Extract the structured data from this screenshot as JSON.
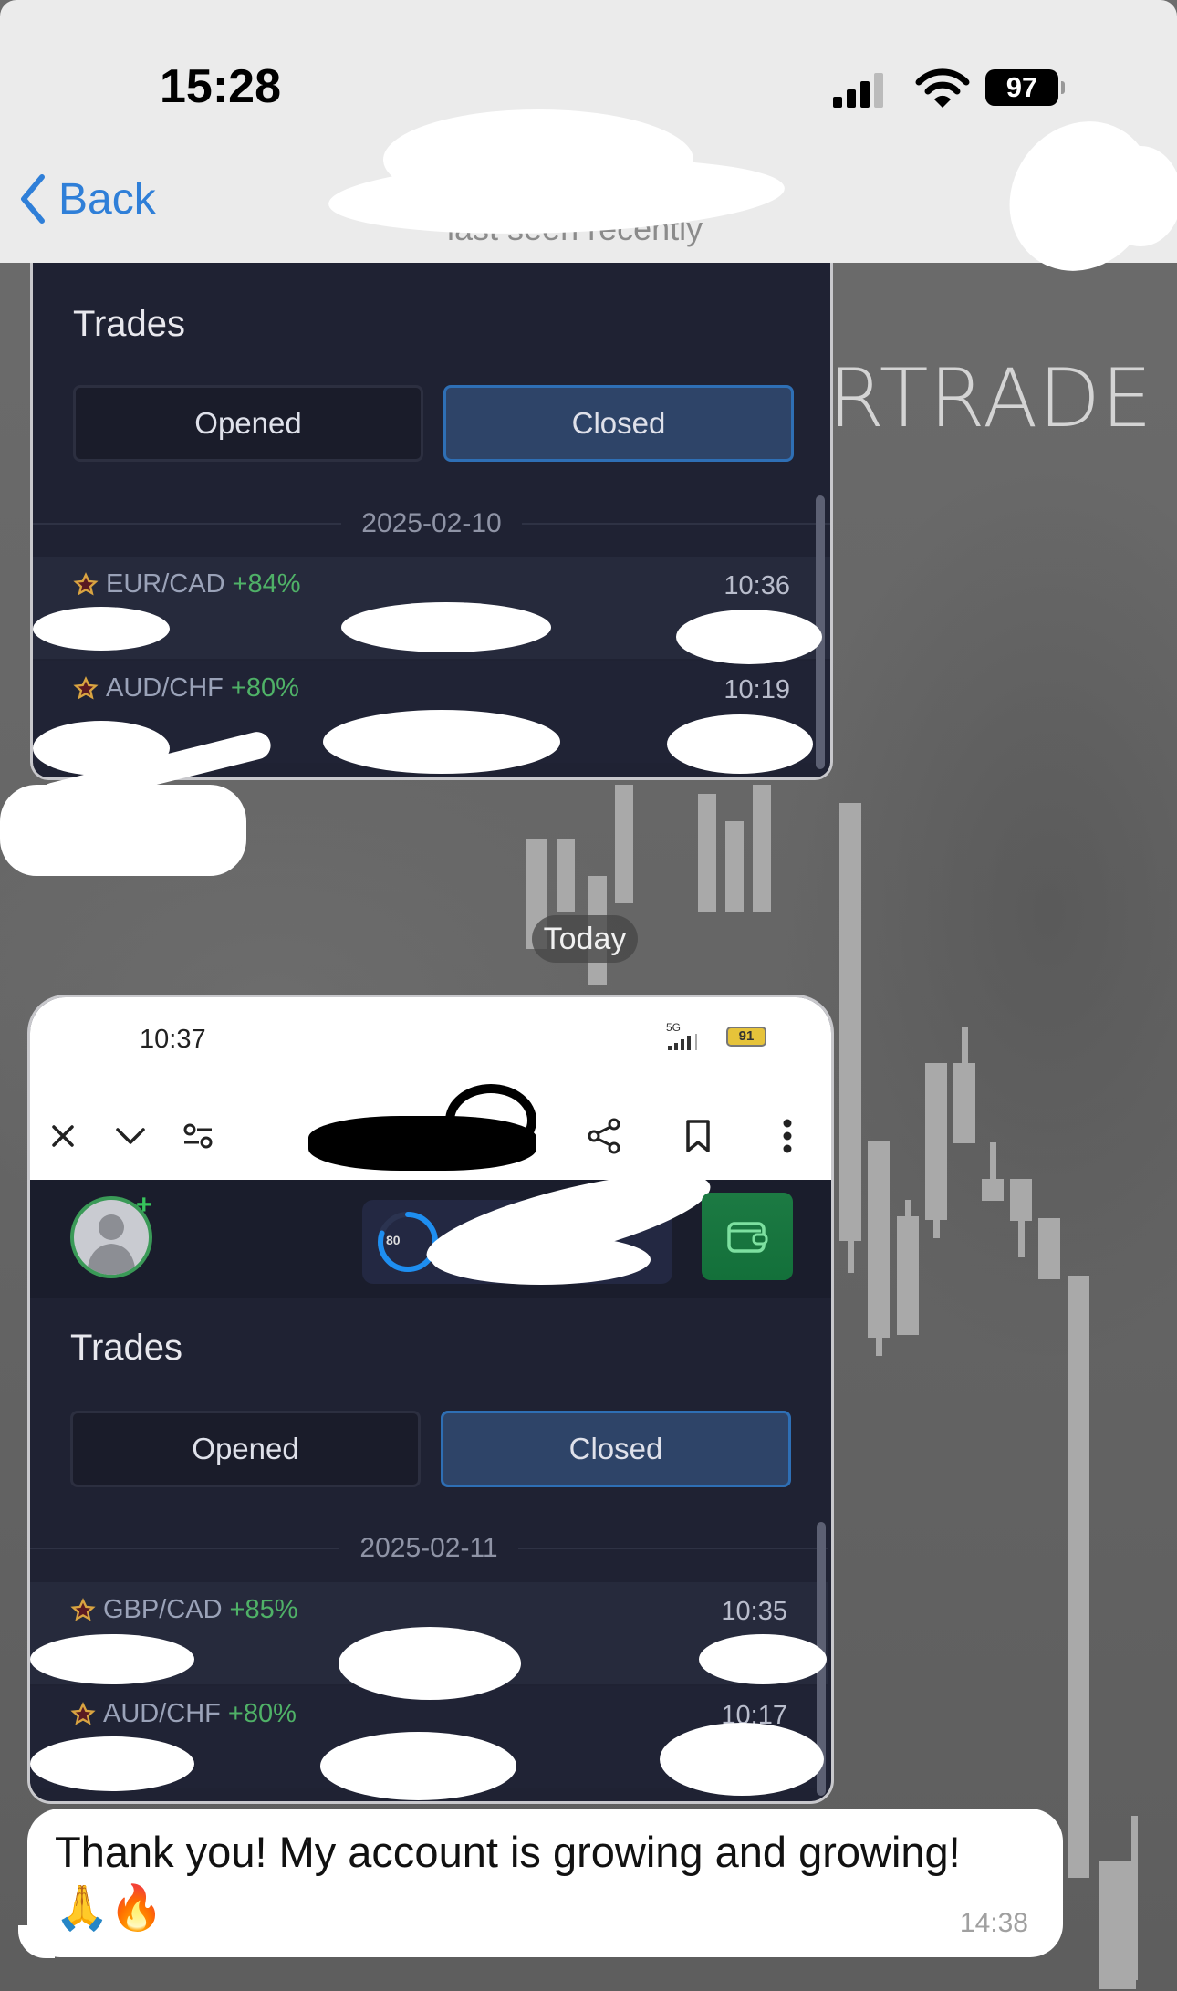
{
  "status_bar": {
    "time": "15:28",
    "battery": "97",
    "icons": [
      "cellular-signal-icon",
      "wifi-icon",
      "battery-icon"
    ]
  },
  "nav": {
    "back_label": "Back",
    "chat_status": "last seen recently"
  },
  "wallpaper": {
    "watermark": "RTRADE"
  },
  "messages": [
    {
      "type": "screenshot",
      "trades_title": "Trades",
      "tabs": [
        {
          "label": "Opened",
          "active": false
        },
        {
          "label": "Closed",
          "active": true
        }
      ],
      "date": "2025-02-10",
      "trades": [
        {
          "pair": "EUR/CAD",
          "payout": "+84%",
          "time": "10:36"
        },
        {
          "pair": "AUD/CHF",
          "payout": "+80%",
          "time": "10:19"
        }
      ]
    },
    {
      "type": "date_separator",
      "label": "Today"
    },
    {
      "type": "screenshot",
      "phone_status": {
        "time": "10:37",
        "network": "5G",
        "battery": "91"
      },
      "browser_toolbar": [
        "close-icon",
        "chevron-down-icon",
        "site-settings-icon",
        "share-icon",
        "bookmark-icon",
        "more-vertical-icon"
      ],
      "progress_label": "80",
      "progress_fraction": 0.8,
      "trades_title": "Trades",
      "tabs": [
        {
          "label": "Opened",
          "active": false
        },
        {
          "label": "Closed",
          "active": true
        }
      ],
      "date": "2025-02-11",
      "trades": [
        {
          "pair": "GBP/CAD",
          "payout": "+85%",
          "time": "10:35"
        },
        {
          "pair": "AUD/CHF",
          "payout": "+80%",
          "time": "10:17"
        }
      ]
    },
    {
      "type": "text",
      "text": "Thank you! My account is growing and growing!",
      "emoji": "🙏🔥",
      "time": "14:38"
    }
  ],
  "colors": {
    "card_bg": "#1f2233",
    "accent_blue": "#2e6fb5",
    "payout_green": "#4fb167",
    "star_gold": "#d9a441",
    "ios_link": "#2f7fd8",
    "wallet_green": "#1c7a43"
  }
}
